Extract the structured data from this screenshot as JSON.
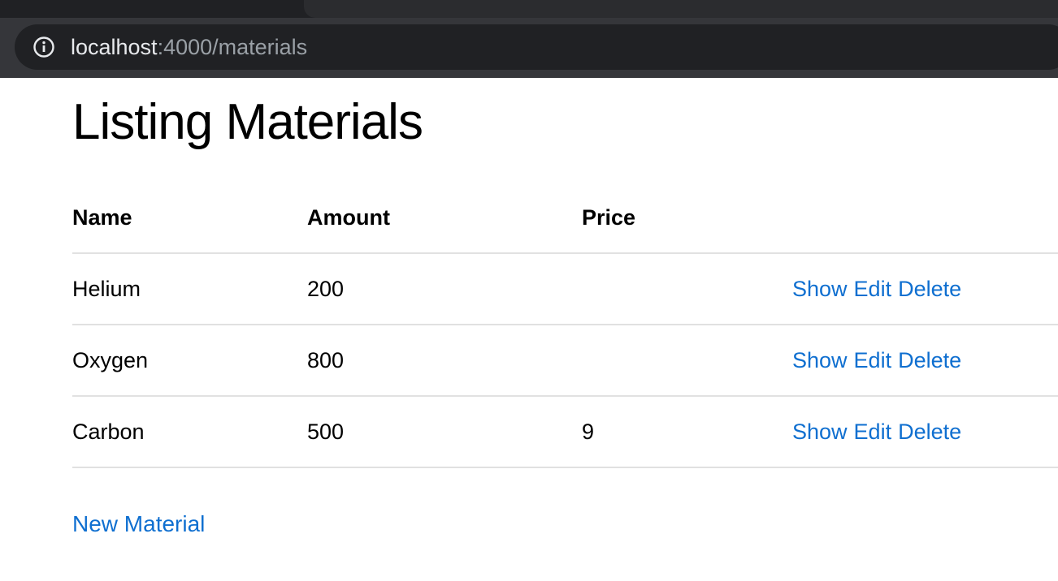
{
  "browser": {
    "url_host": "localhost",
    "url_path": ":4000/materials",
    "icon": "info-icon"
  },
  "page": {
    "title": "Listing Materials"
  },
  "table": {
    "headers": [
      "Name",
      "Amount",
      "Price",
      ""
    ],
    "rows": [
      {
        "name": "Helium",
        "amount": "200",
        "price": "",
        "actions": [
          "Show",
          "Edit",
          "Delete"
        ]
      },
      {
        "name": "Oxygen",
        "amount": "800",
        "price": "",
        "actions": [
          "Show",
          "Edit",
          "Delete"
        ]
      },
      {
        "name": "Carbon",
        "amount": "500",
        "price": "9",
        "actions": [
          "Show",
          "Edit",
          "Delete"
        ]
      }
    ]
  },
  "new_link": "New Material",
  "colors": {
    "link": "#0f6fd0",
    "chrome_bg": "#35363a",
    "omnibox_bg": "#202124"
  }
}
